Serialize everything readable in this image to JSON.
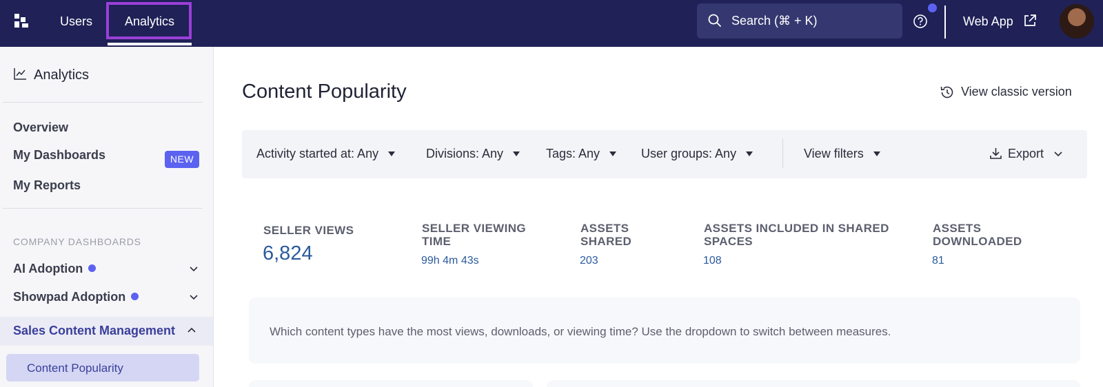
{
  "topbar": {
    "nav": {
      "users": "Users",
      "analytics": "Analytics"
    },
    "search": {
      "placeholder": "Search (⌘ + K)"
    },
    "web_app_label": "Web App",
    "icons": [
      "logo-icon",
      "search-icon",
      "help-icon",
      "external-link-icon",
      "avatar"
    ],
    "colors": {
      "bar_bg": "#1f2157",
      "highlight": "#9b3fd8",
      "notification": "#5b62f0"
    }
  },
  "sidebar": {
    "title": "Analytics",
    "links": [
      {
        "label": "Overview"
      },
      {
        "label": "My Dashboards",
        "badge": "NEW"
      },
      {
        "label": "My Reports"
      }
    ],
    "section_header": "COMPANY DASHBOARDS",
    "dashboards": [
      {
        "label": "AI Adoption",
        "dot": true,
        "expanded": false
      },
      {
        "label": "Showpad Adoption",
        "dot": true,
        "expanded": false
      },
      {
        "label": "Sales Content Management",
        "dot": false,
        "expanded": true
      }
    ],
    "active_subitem": "Content Popularity"
  },
  "main": {
    "title": "Content Popularity",
    "classic_link": "View classic version",
    "filters": [
      {
        "label": "Activity started at: Any"
      },
      {
        "label": "Divisions: Any"
      },
      {
        "label": "Tags: Any"
      },
      {
        "label": "User groups: Any"
      }
    ],
    "view_filters_label": "View filters",
    "export_label": "Export",
    "metrics": [
      {
        "label": "SELLER VIEWS",
        "value": "6,824"
      },
      {
        "label": "SELLER VIEWING TIME",
        "value": "99h 4m 43s"
      },
      {
        "label": "ASSETS SHARED",
        "value": "203"
      },
      {
        "label": "ASSETS INCLUDED IN SHARED SPACES",
        "value": "108"
      },
      {
        "label": "ASSETS DOWNLOADED",
        "value": "81"
      }
    ],
    "question": "Which content types have the most views, downloads, or viewing time? Use the dropdown to switch between measures."
  }
}
